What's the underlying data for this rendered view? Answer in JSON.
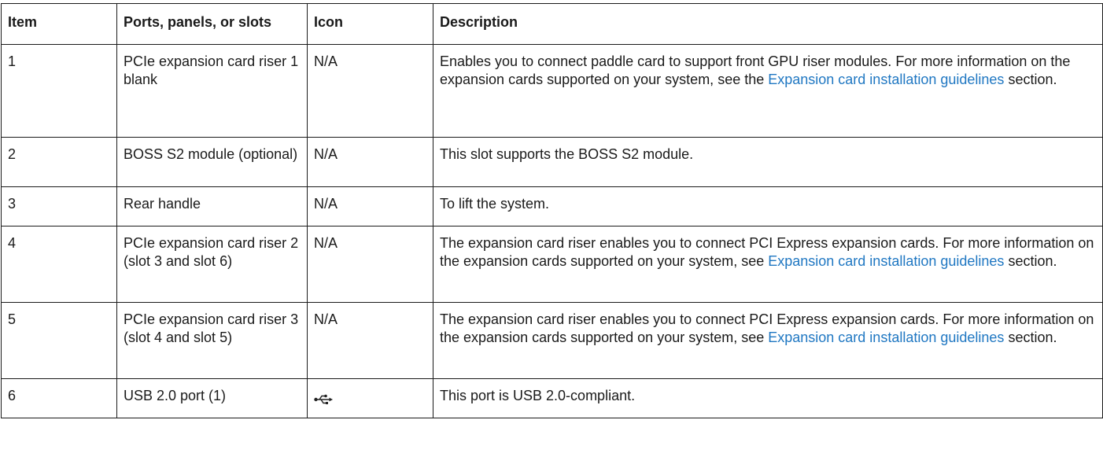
{
  "table": {
    "headers": [
      "Item",
      "Ports, panels, or slots",
      "Icon",
      "Description"
    ],
    "link_color": "#1f77c2",
    "rows": [
      {
        "item": "1",
        "port": "PCIe expansion card riser 1 blank",
        "icon": "N/A",
        "desc_before": "Enables you to connect paddle card to support front GPU riser modules. For more information on the expansion cards supported on your system, see the ",
        "desc_link": "Expansion card installation guidelines",
        "desc_after": " section."
      },
      {
        "item": "2",
        "port": "BOSS S2 module (optional)",
        "icon": "N/A",
        "desc": "This slot supports the BOSS S2 module."
      },
      {
        "item": "3",
        "port": "Rear handle",
        "icon": "N/A",
        "desc": "To lift the system."
      },
      {
        "item": "4",
        "port": "PCIe expansion card riser 2 (slot 3 and slot 6)",
        "icon": "N/A",
        "desc_before": "The expansion card riser enables you to connect PCI Express expansion cards. For more information on the expansion cards supported on your system, see ",
        "desc_link": "Expansion card installation guidelines",
        "desc_after": " section."
      },
      {
        "item": "5",
        "port": "PCIe expansion card riser 3 (slot 4 and slot 5)",
        "icon": "N/A",
        "desc_before": "The expansion card riser enables you to connect PCI Express expansion cards. For more information on the expansion cards supported on your system, see ",
        "desc_link": "Expansion card installation guidelines",
        "desc_after": " section."
      },
      {
        "item": "6",
        "port": "USB 2.0 port (1)",
        "icon_name": "usb-icon",
        "desc": "This port is USB 2.0-compliant."
      }
    ]
  }
}
